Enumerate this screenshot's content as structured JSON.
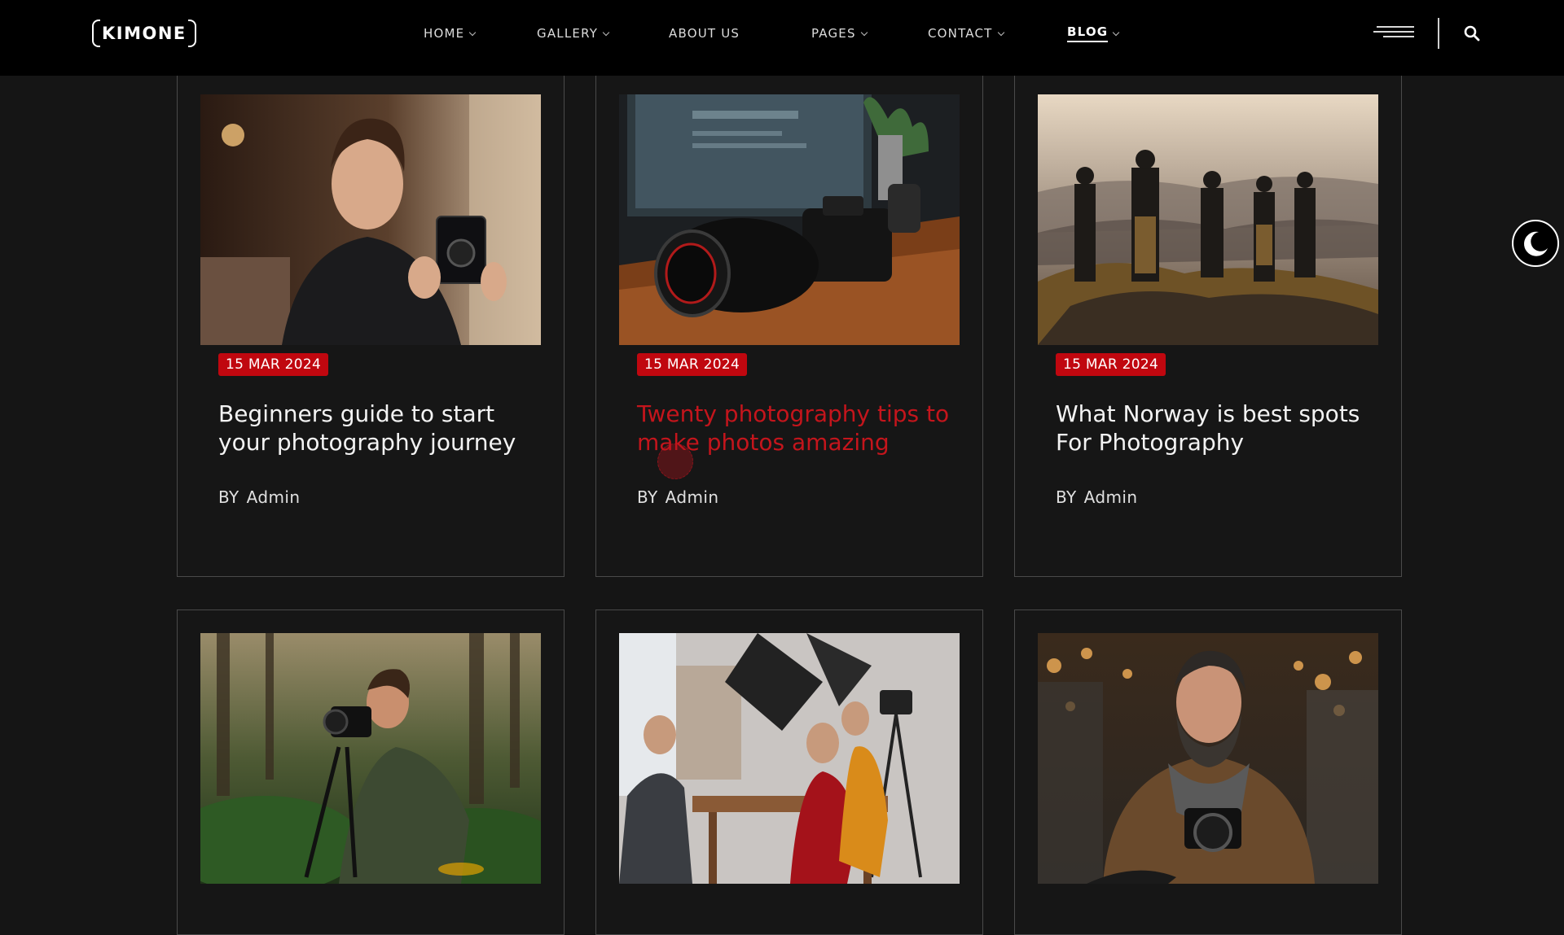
{
  "brand": {
    "logo_text": "KIMONE"
  },
  "nav": {
    "items": [
      {
        "label": "HOME",
        "dropdown": true
      },
      {
        "label": "GALLERY",
        "dropdown": true
      },
      {
        "label": "ABOUT US",
        "dropdown": false
      },
      {
        "label": "PAGES",
        "dropdown": true
      },
      {
        "label": "CONTACT",
        "dropdown": true
      },
      {
        "label": "BLOG",
        "dropdown": true,
        "active": true
      }
    ]
  },
  "header_icons": [
    "menu-icon",
    "search-icon"
  ],
  "theme_toggle_icon": "moon-icon",
  "colors": {
    "accent": "#c0070f",
    "background": "#151515",
    "header": "#000000"
  },
  "posts": [
    {
      "date": "15 MAR 2024",
      "title": "Beginners guide to start your photography journey",
      "by": "BY",
      "author": "Admin",
      "image": "woman-holding-camera"
    },
    {
      "date": "15 MAR 2024",
      "title": "Twenty photography tips to make photos amazing",
      "by": "BY",
      "author": "Admin",
      "image": "camera-on-desk",
      "hovered": true
    },
    {
      "date": "15 MAR 2024",
      "title": "What Norway is best spots For Photography",
      "by": "BY",
      "author": "Admin",
      "image": "photographers-on-mountain"
    },
    {
      "image": "photographer-in-forest"
    },
    {
      "image": "photo-studio-team"
    },
    {
      "image": "bearded-man-with-camera"
    }
  ]
}
